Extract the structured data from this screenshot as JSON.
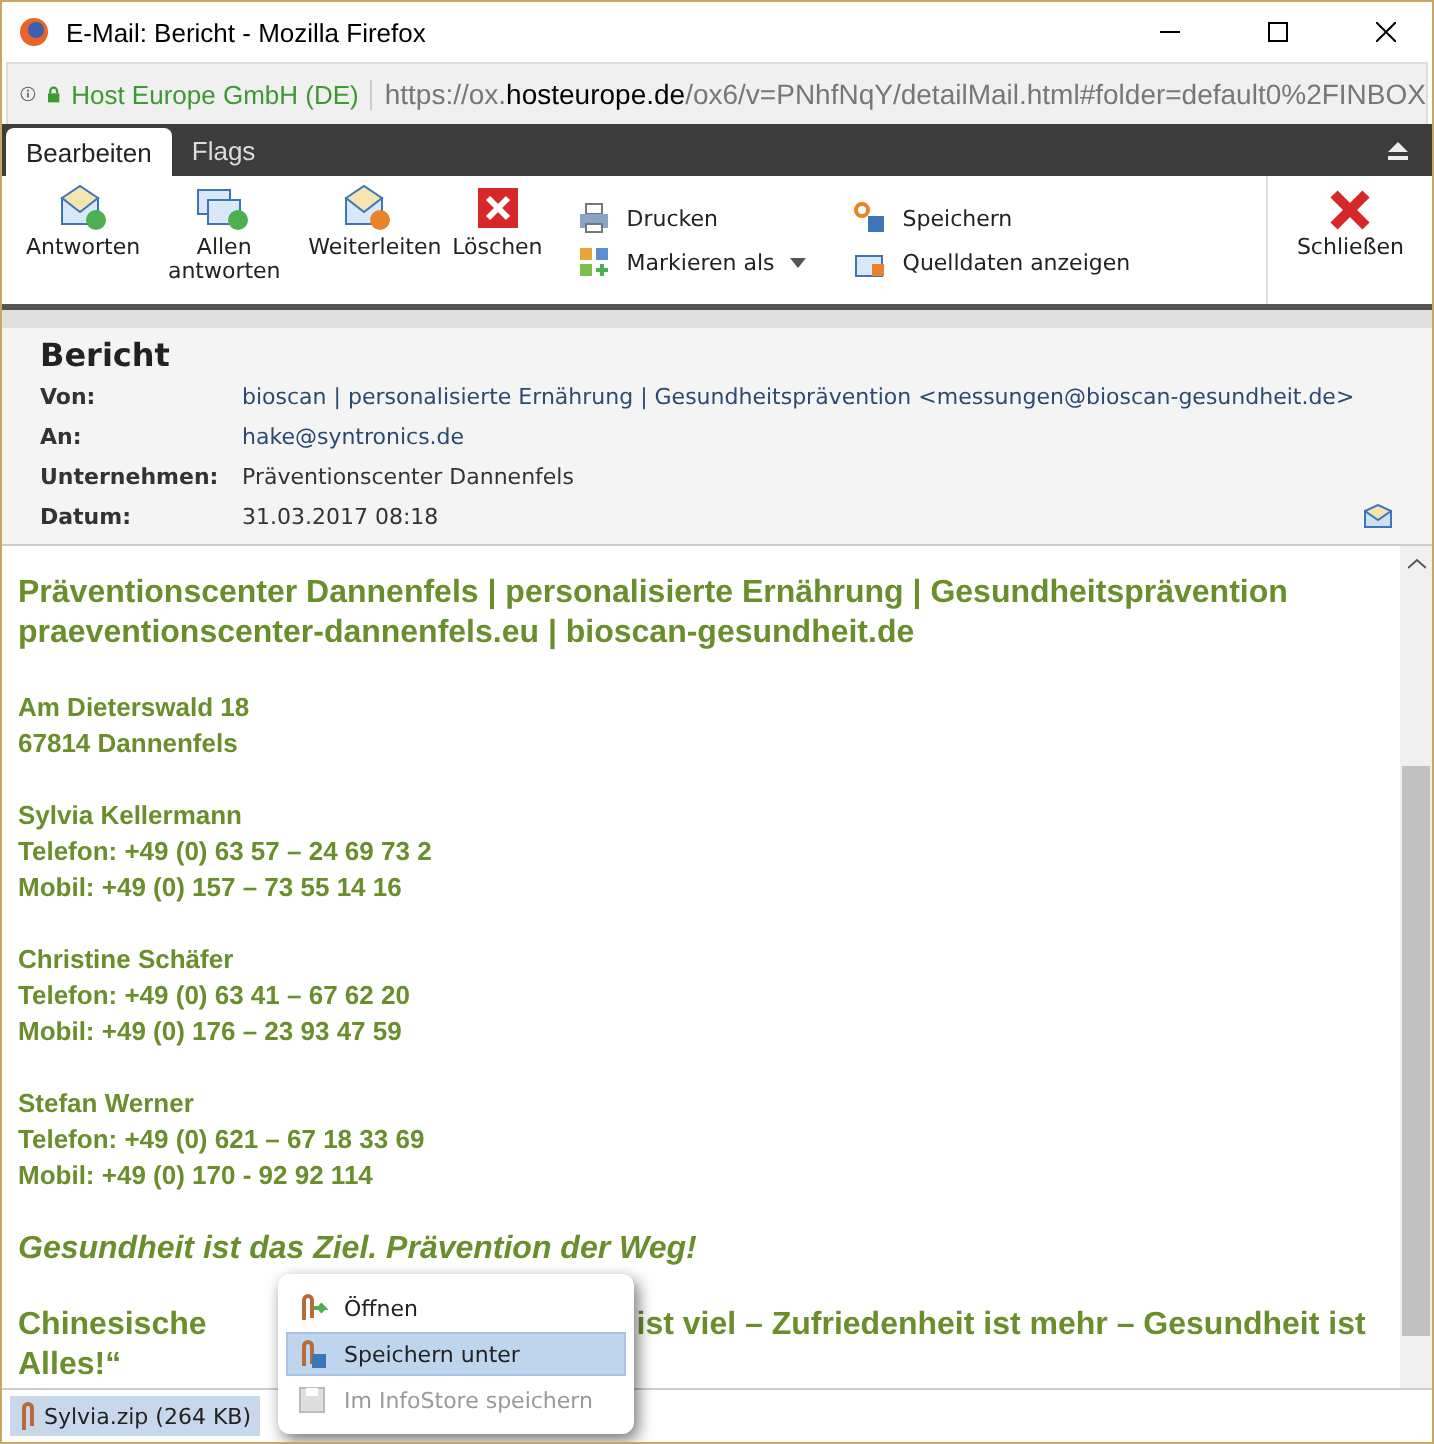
{
  "window": {
    "title": "E-Mail: Bericht - Mozilla Firefox"
  },
  "address_bar": {
    "identity": "Host Europe GmbH (DE)",
    "url_start": "https://ox.",
    "url_domain": "hosteurope.de",
    "url_end": "/ox6/v=PNhfNqY/detailMail.html#folder=default0%2FINBOX"
  },
  "tabs": [
    {
      "label": "Bearbeiten",
      "selected": true
    },
    {
      "label": "Flags",
      "selected": false
    }
  ],
  "toolbar": {
    "large_buttons": [
      "Antworten",
      "Allen antworten",
      "Weiterleiten",
      "Löschen"
    ],
    "small_columns": [
      [
        {
          "label": "Drucken",
          "dropdown": false
        },
        {
          "label": "Markieren als",
          "dropdown": true
        }
      ],
      [
        {
          "label": "Speichern",
          "dropdown": false
        },
        {
          "label": "Quelldaten anzeigen",
          "dropdown": false
        }
      ]
    ],
    "close_button": "Schließen"
  },
  "header": {
    "subject": "Bericht",
    "fields": [
      {
        "label": "Von:",
        "value": "bioscan | personalisierte Ernährung | Gesundheitsprävention <messungen@bioscan-gesundheit.de>",
        "link": true
      },
      {
        "label": "An:",
        "value": "hake@syntronics.de",
        "link": true
      },
      {
        "label": "Unternehmen:",
        "value": "Präventionscenter Dannenfels",
        "link": false
      },
      {
        "label": "Datum:",
        "value": "31.03.2017 08:18",
        "link": false
      }
    ]
  },
  "body": [
    {
      "kind": "heading",
      "lines": [
        "Präventionscenter Dannenfels | personalisierte Ernährung | Gesundheitsprävention",
        "praeventionscenter-dannenfels.eu | bioscan-gesundheit.de"
      ]
    },
    {
      "kind": "lines",
      "lines": [
        "Am Dieterswald 18",
        "67814 Dannenfels"
      ]
    },
    {
      "kind": "lines",
      "lines": [
        "Sylvia Kellermann",
        "Telefon: +49 (0) 63 57 – 24 69 73 2",
        "Mobil: +49 (0) 157 – 73 55 14 16"
      ]
    },
    {
      "kind": "lines",
      "lines": [
        "Christine Schäfer",
        "Telefon: +49 (0) 63 41 – 67 62 20",
        "Mobil: +49 (0) 176 – 23 93 47 59"
      ]
    },
    {
      "kind": "lines",
      "lines": [
        "Stefan Werner",
        "Telefon: +49 (0) 621 – 67 18 33 69",
        "Mobil: +49 (0) 170 - 92 92 114"
      ]
    },
    {
      "kind": "slogan",
      "lines": [
        "Gesundheit ist das Ziel. Prävention der Weg!"
      ]
    },
    {
      "kind": "covered",
      "lines": [
        "Chinesische",
        "ist viel – Zufriedenheit ist mehr – Gesundheit ist",
        "Alles!“"
      ]
    }
  ],
  "context_menu": [
    {
      "label": "Öffnen",
      "selected": false,
      "disabled": false
    },
    {
      "label": "Speichern unter",
      "selected": true,
      "disabled": false
    },
    {
      "label": "Im InfoStore speichern",
      "selected": false,
      "disabled": true
    }
  ],
  "attachment": {
    "name": "Sylvia.zip (264 KB)"
  }
}
